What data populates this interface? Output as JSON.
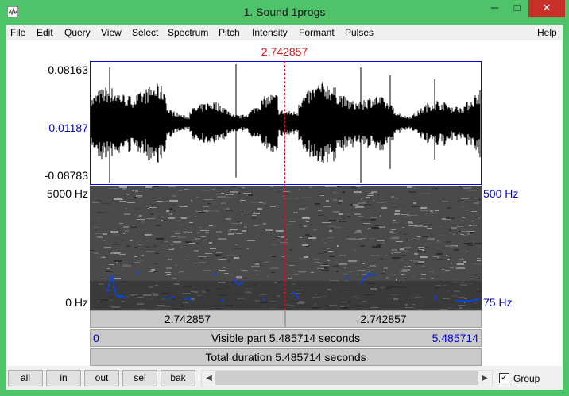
{
  "window": {
    "title": "1. Sound 1progs",
    "controls": {
      "minimize": "─",
      "maximize": "□",
      "close": "✕"
    },
    "colors": {
      "frame": "#4fc36a",
      "close": "#c7312a"
    }
  },
  "menu": {
    "items": [
      "File",
      "Edit",
      "Query",
      "View",
      "Select",
      "Spectrum",
      "Pitch",
      "Intensity",
      "Formant",
      "Pulses"
    ],
    "help": "Help"
  },
  "editor": {
    "cursor_time": "2.742857",
    "waveform": {
      "max": "0.08163",
      "mid": "-0.01187",
      "min": "-0.08783"
    },
    "spectrogram": {
      "freq_max": "5000 Hz",
      "freq_min": "0 Hz"
    },
    "pitch": {
      "max": "500 Hz",
      "min": "75 Hz"
    },
    "colors": {
      "cursor": "#d01616",
      "pitch": "#0044ff",
      "axis_blue": "#0000cc"
    }
  },
  "time_bars": {
    "left_segment": "2.742857",
    "right_segment": "2.742857",
    "visible_start": "0",
    "visible_label": "Visible part 5.485714 seconds",
    "visible_end": "5.485714",
    "total_label": "Total duration 5.485714 seconds"
  },
  "bottom": {
    "buttons": [
      "all",
      "in",
      "out",
      "sel",
      "bak"
    ],
    "group_label": "Group",
    "group_checked": true
  }
}
